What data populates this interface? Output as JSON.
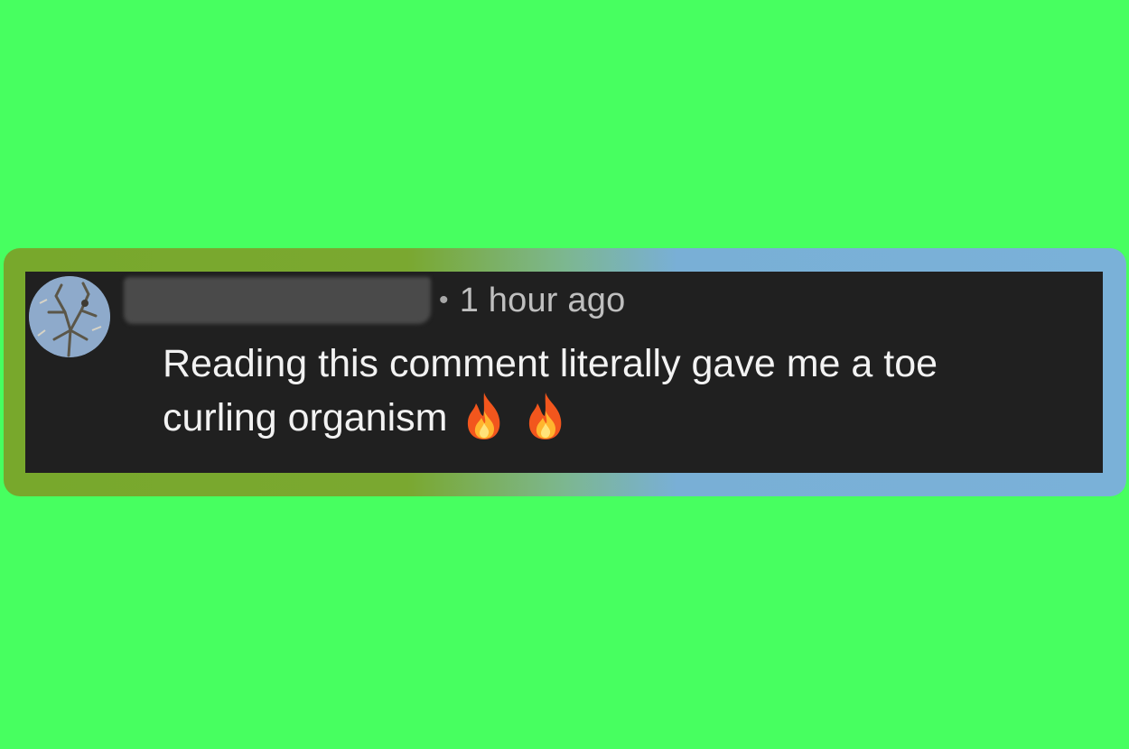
{
  "comment": {
    "meta_separator": "•",
    "timestamp": "1 hour ago",
    "text_line1": "Reading this comment literally gave me a toe",
    "text_line2": "curling organism",
    "emojis": [
      "fire-emoji",
      "fire-emoji"
    ]
  },
  "colors": {
    "background": "#47ff60",
    "card": "#202020",
    "frame_left": "#78a82c",
    "frame_right": "#7ab1d8",
    "text": "#f2f2f2",
    "meta_text": "#bfbfbf"
  }
}
